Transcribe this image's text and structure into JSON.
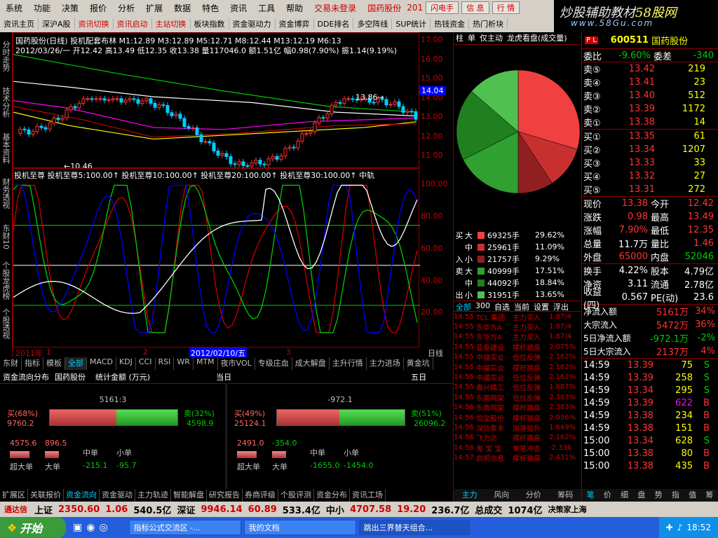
{
  "menu": [
    "系统",
    "功能",
    "决策",
    "报价",
    "分析",
    "扩展",
    "数据",
    "特色",
    "资讯",
    "工具",
    "帮助"
  ],
  "menu_red": "交易未登录",
  "menu_stock": "国药股份",
  "menu_btns": [
    "闪电手",
    "信 息",
    "行 情"
  ],
  "menu_tail": "201",
  "logo": {
    "l1a": "炒股辅助教材",
    "l1b": "58股网",
    "l2": "www.58Gu.com"
  },
  "toolbar": [
    "资讯主页",
    "深沪A股",
    "资讯切换",
    "资讯启动",
    "主站切换",
    "板块指数",
    "资金驱动力",
    "资金博弈",
    "DDE排名",
    "多空阵线",
    "SUP统计",
    "热钱资金",
    "热门析块"
  ],
  "toolbar_red": [
    2,
    3,
    4
  ],
  "leftstrip": [
    "分时走势",
    "技术分析",
    "基本资料",
    "财务透视",
    "东财10",
    "个股龙虎榜",
    "个股透视"
  ],
  "kline": {
    "label1": "国药股份(日线) 投机配套布林  M1:12.89  M3:12.89  M5:12.71  M8:12.44  M13:12.19  M6:13",
    "label2": "2012/03/26/一 开12.42 高13.49 低12.35 收13.38 量117046.0 额1.51亿 幅0.98(7.90%) 振1.14(9.19%)",
    "yticks": [
      "17.00",
      "16.00",
      "15.00",
      "14.00",
      "13.00",
      "12.00",
      "11.00"
    ],
    "price_tag": "14.04",
    "low_label": "10.46",
    "high_label": "13.86"
  },
  "indicator": {
    "label": "投机至尊  投机至尊5:100.00↑ 投机至尊10:100.00↑ 投机至尊20:100.00↑ 投机至尊30:100.00↑ 中轨",
    "yticks": [
      "100.00",
      "80.00",
      "60.00",
      "40.00",
      "20.00"
    ]
  },
  "datebar": {
    "d1": "2011年",
    "m1": "1",
    "m2": "2",
    "d2": "2012/02/10/五",
    "m3": "3",
    "period": "日线"
  },
  "tabs": [
    "东财",
    "指标",
    "模板",
    "全部",
    "MACD",
    "KDJ",
    "CCI",
    "RSI",
    "WR",
    "MTM",
    "夜市VOL",
    "专级庄血",
    "成大解盘",
    "主升行情",
    "主力进场",
    "黄金坑"
  ],
  "flowhdr": {
    "a": "资金流向分布",
    "b": "国药股份",
    "c": "统计金额 (万元)",
    "d": "当日",
    "e": "五日"
  },
  "flow_today": {
    "total": "5161:3",
    "buy_pct": "买(68%)",
    "buy": "9760.2",
    "sell_pct": "卖(32%)",
    "sell": "4598.9",
    "super": "4575.6",
    "big": "896.5",
    "mid": "-215.1",
    "small": "-95.7"
  },
  "flow_5d": {
    "total": "-972.1",
    "buy_pct": "买(49%)",
    "buy": "25124.1",
    "sell_pct": "卖(51%)",
    "sell": "26096.2",
    "super": "2491.0",
    "big": "-354.0",
    "mid": "-1655.0",
    "small": "-1454.0"
  },
  "flow_labels": {
    "super": "超大单",
    "big": "大单",
    "mid": "中单",
    "small": "小单"
  },
  "btmtabs": [
    "扩展区",
    "关联报价",
    "资金流向",
    "资金驱动",
    "主力轨迹",
    "智能解盘",
    "研究报告",
    "券商评级",
    "个股评测",
    "资金分布",
    "资讯工场"
  ],
  "mid": {
    "tabs": [
      "柱",
      "单",
      "仅主动",
      "龙虎看盘(成交量)"
    ],
    "pie": [
      29.62,
      11.09,
      9.29,
      17.51,
      18.84,
      13.65
    ],
    "pie_colors": [
      "#f04040",
      "#c83030",
      "#902020",
      "#30a030",
      "#208020",
      "#50c050"
    ],
    "orders": [
      {
        "side": "买",
        "size": "大",
        "vol": "69325手",
        "pct": "29.62%"
      },
      {
        "side": "",
        "size": "中",
        "vol": "25961手",
        "pct": "11.09%"
      },
      {
        "side": "入",
        "size": "小",
        "vol": "21757手",
        "pct": "9.29%"
      },
      {
        "side": "卖",
        "size": "大",
        "vol": "40999手",
        "pct": "17.51%"
      },
      {
        "side": "",
        "size": "中",
        "vol": "44092手",
        "pct": "18.84%"
      },
      {
        "side": "出",
        "size": "小",
        "vol": "31951手",
        "pct": "13.65%"
      }
    ],
    "subtabs": [
      "全部",
      "300",
      "自选",
      "当前",
      "设置",
      "浮出"
    ],
    "news": [
      [
        "14:55",
        "TCL 集团",
        "主力买入",
        "1.87/4"
      ],
      [
        "14:55",
        "东华方A",
        "主力买入",
        "1.87/4"
      ],
      [
        "14:55",
        "东华方A",
        "主力买入",
        "1.87/4"
      ],
      [
        "14:55",
        "亚泰建设",
        "撑杆跳高",
        "2.075%"
      ],
      [
        "14:55",
        "中福实业",
        "低位反弹",
        "2.162%"
      ],
      [
        "14:55",
        "中福实业",
        "撑杆跳高",
        "2.162%"
      ],
      [
        "14:55",
        "中福实业",
        "低位反弹",
        "2.162%"
      ],
      [
        "14:55",
        "春兴精工",
        "低位反弹",
        "1.687%"
      ],
      [
        "14:55",
        "东南网架",
        "低位反弹",
        "2.383%"
      ],
      [
        "14:56",
        "东南网架",
        "撑杆跳高",
        "2.383%"
      ],
      [
        "14:56",
        "恒宝股份",
        "撑杆跳高",
        "2.036%"
      ],
      [
        "14:56",
        "深信泰丰",
        "加速拉升",
        "1.649%"
      ],
      [
        "14:56",
        "飞力达",
        "撑杆跳高",
        "2.162%"
      ],
      [
        "14:56",
        "鬼 宝 宝",
        "单笔冲击",
        "-2.336"
      ],
      [
        "14:57",
        "启明信息",
        "撑杆跳高",
        "2.431%"
      ]
    ],
    "bottom": [
      "主力",
      "风向",
      "分价",
      "筹码"
    ]
  },
  "right": {
    "code": "600511",
    "name": "国药股份",
    "ratio": "委比",
    "ratio_val": "-9.60%",
    "diff": "委差",
    "diff_val": "-340",
    "sells": [
      [
        "卖⑤",
        "13.42",
        "219"
      ],
      [
        "卖④",
        "13.41",
        "23"
      ],
      [
        "卖③",
        "13.40",
        "512"
      ],
      [
        "卖②",
        "13.39",
        "1172"
      ],
      [
        "卖①",
        "13.38",
        "14"
      ]
    ],
    "buys": [
      [
        "买①",
        "13.35",
        "61"
      ],
      [
        "买②",
        "13.34",
        "1207"
      ],
      [
        "买③",
        "13.33",
        "33"
      ],
      [
        "买④",
        "13.32",
        "27"
      ],
      [
        "买⑤",
        "13.31",
        "272"
      ]
    ],
    "quote": [
      [
        "现价",
        "13.38",
        "今开",
        "12.42"
      ],
      [
        "涨跌",
        "0.98",
        "最高",
        "13.49"
      ],
      [
        "涨幅",
        "7.90%",
        "最低",
        "12.35"
      ],
      [
        "总量",
        "11.7万",
        "量比",
        "1.46"
      ],
      [
        "外盘",
        "65000",
        "内盘",
        "52046"
      ]
    ],
    "fin": [
      [
        "换手",
        "4.22%",
        "股本",
        "4.79亿"
      ],
      [
        "净资",
        "3.11",
        "流通",
        "2.78亿"
      ],
      [
        "收益(四)",
        "0.567",
        "PE(动)",
        "23.6"
      ]
    ],
    "flows": [
      [
        "净流入额",
        "5161万",
        "34%"
      ],
      [
        "大宗流入",
        "5472万",
        "36%"
      ],
      [
        "5日净流入额",
        "-972.1万",
        "-2%"
      ],
      [
        "5日大宗流入",
        "2137万",
        "4%"
      ]
    ],
    "ticks": [
      [
        "14:59",
        "13.39",
        "75",
        "S"
      ],
      [
        "14:59",
        "13.39",
        "258",
        "S"
      ],
      [
        "14:59",
        "13.34",
        "295",
        "S"
      ],
      [
        "14:59",
        "13.39",
        "622",
        "B"
      ],
      [
        "14:59",
        "13.38",
        "234",
        "B"
      ],
      [
        "14:59",
        "13.38",
        "151",
        "B"
      ],
      [
        "15:00",
        "13.34",
        "628",
        "S"
      ],
      [
        "15:00",
        "13.38",
        "80",
        "B"
      ],
      [
        "15:00",
        "13.38",
        "435",
        "B"
      ]
    ],
    "bottom": [
      "笔",
      "价",
      "细",
      "盘",
      "势",
      "指",
      "值",
      "筹"
    ]
  },
  "status": {
    "app": "通达信",
    "sh": "上证",
    "sh_v": "2350.60",
    "sh_c": "1.06",
    "sh_a": "540.5亿",
    "sz": "深证",
    "sz_v": "9946.14",
    "sz_c": "60.89",
    "sz_a": "533.4亿",
    "zx": "中小",
    "zx_v": "4707.58",
    "zx_c": "19.20",
    "zx_a": "236.7亿",
    "cj": "总成交",
    "cj_v": "1074亿",
    "tail": "决策家上海"
  },
  "taskbar": {
    "start": "开始",
    "t1": "指标公式交流区 -...",
    "t2": "我的文档",
    "t3": "跳出三界替天组合...",
    "time": "18:52"
  }
}
